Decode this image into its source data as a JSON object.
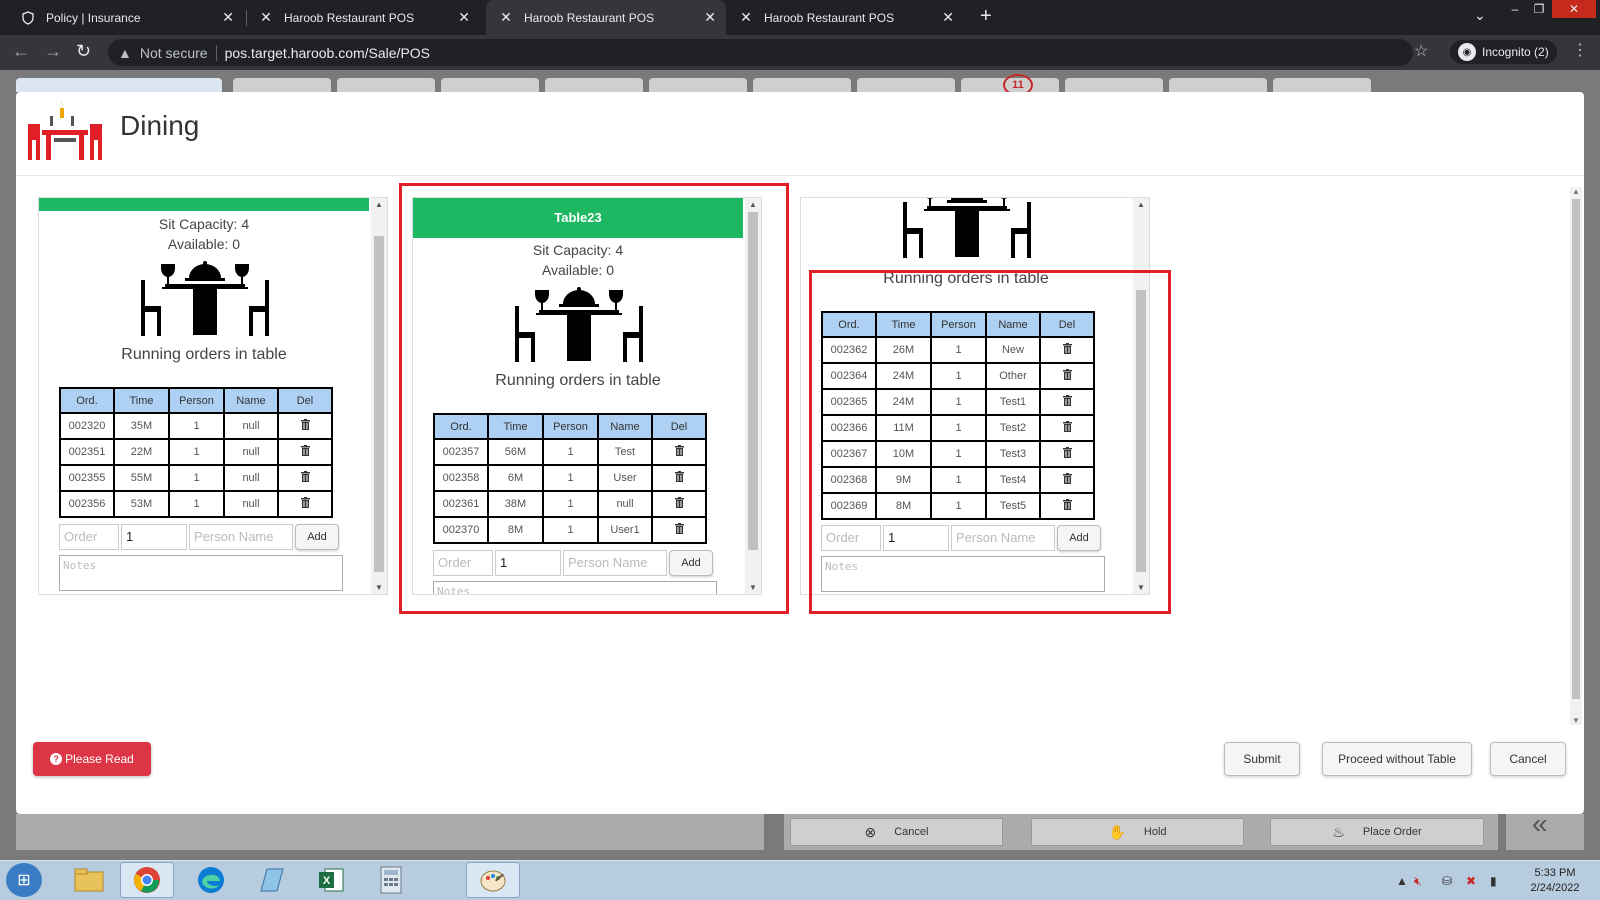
{
  "browser": {
    "tabs": [
      {
        "title": "Policy | Insurance",
        "icon": "shield-icon"
      },
      {
        "title": "Haroob Restaurant POS",
        "icon": "x-logo-icon"
      },
      {
        "title": "Haroob Restaurant POS",
        "icon": "x-logo-icon",
        "active": true
      },
      {
        "title": "Haroob Restaurant POS",
        "icon": "x-logo-icon"
      }
    ],
    "security_label": "Not secure",
    "url": "pos.target.haroob.com/Sale/POS",
    "incognito_label": "Incognito (2)"
  },
  "background": {
    "badge_count": "11",
    "bottom_buttons": [
      {
        "label": "Cancel",
        "icon": "cancel-circle-icon"
      },
      {
        "label": "Hold",
        "icon": "hand-icon"
      },
      {
        "label": "Place Order",
        "icon": "chef-icon"
      }
    ]
  },
  "modal": {
    "title": "Dining",
    "cards": [
      {
        "table_name": "",
        "sit_capacity": "Sit Capacity: 4",
        "available": "Available: 0",
        "running_label": "Running orders in table",
        "columns": [
          "Ord.",
          "Time",
          "Person",
          "Name",
          "Del"
        ],
        "rows": [
          [
            "002320",
            "35M",
            "1",
            "null"
          ],
          [
            "002351",
            "22M",
            "1",
            "null"
          ],
          [
            "002355",
            "55M",
            "1",
            "null"
          ],
          [
            "002356",
            "53M",
            "1",
            "null"
          ]
        ],
        "order_placeholder": "Order",
        "person_count": "1",
        "person_name_placeholder": "Person Name",
        "add_label": "Add",
        "notes_placeholder": "Notes"
      },
      {
        "table_name": "Table23",
        "sit_capacity": "Sit Capacity: 4",
        "available": "Available: 0",
        "running_label": "Running orders in table",
        "columns": [
          "Ord.",
          "Time",
          "Person",
          "Name",
          "Del"
        ],
        "rows": [
          [
            "002357",
            "56M",
            "1",
            "Test"
          ],
          [
            "002358",
            "6M",
            "1",
            "User"
          ],
          [
            "002361",
            "38M",
            "1",
            "null"
          ],
          [
            "002370",
            "8M",
            "1",
            "User1"
          ]
        ],
        "order_placeholder": "Order",
        "person_count": "1",
        "person_name_placeholder": "Person Name",
        "add_label": "Add",
        "notes_placeholder": "Notes"
      },
      {
        "table_name": "",
        "running_label": "Running orders in table",
        "columns": [
          "Ord.",
          "Time",
          "Person",
          "Name",
          "Del"
        ],
        "rows": [
          [
            "002362",
            "26M",
            "1",
            "New"
          ],
          [
            "002364",
            "24M",
            "1",
            "Other"
          ],
          [
            "002365",
            "24M",
            "1",
            "Test1"
          ],
          [
            "002366",
            "11M",
            "1",
            "Test2"
          ],
          [
            "002367",
            "10M",
            "1",
            "Test3"
          ],
          [
            "002368",
            "9M",
            "1",
            "Test4"
          ],
          [
            "002369",
            "8M",
            "1",
            "Test5"
          ]
        ],
        "order_placeholder": "Order",
        "person_count": "1",
        "person_name_placeholder": "Person Name",
        "add_label": "Add",
        "notes_placeholder": "Notes"
      }
    ],
    "please_read_label": "Please Read",
    "submit_label": "Submit",
    "proceed_label": "Proceed without Table",
    "cancel_label": "Cancel"
  },
  "taskbar": {
    "time": "5:33 PM",
    "date": "2/24/2022"
  },
  "colors": {
    "accent_green": "#1db861",
    "header_blue": "#aed0f2",
    "highlight_red": "#e21f26",
    "danger": "#dc3545"
  }
}
